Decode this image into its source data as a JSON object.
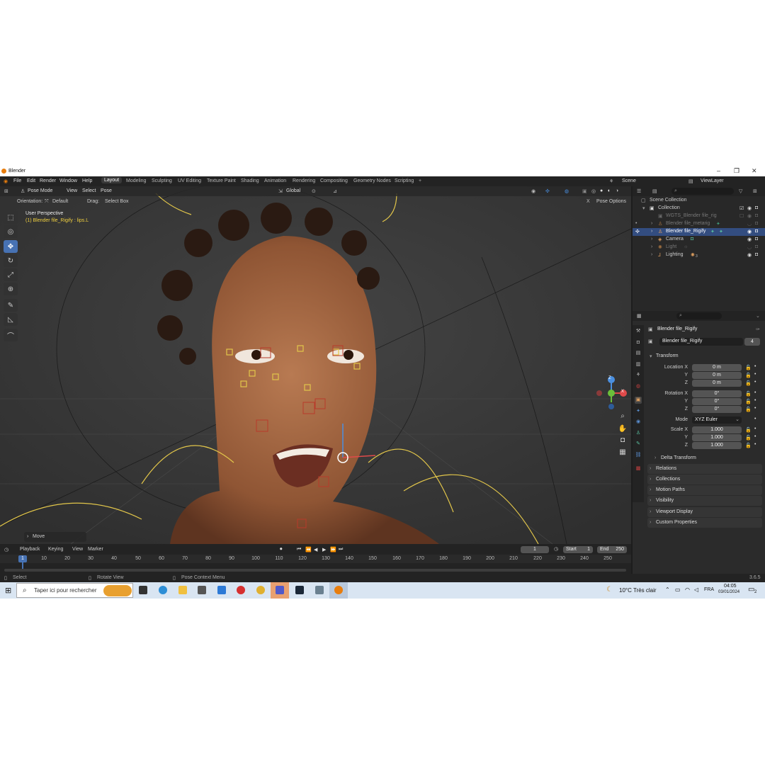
{
  "app": {
    "title": "Blender",
    "version": "3.6.5"
  },
  "menu": [
    "File",
    "Edit",
    "Render",
    "Window",
    "Help"
  ],
  "workspaces": [
    {
      "label": "Layout",
      "active": true
    },
    {
      "label": "Modeling"
    },
    {
      "label": "Sculpting"
    },
    {
      "label": "UV Editing"
    },
    {
      "label": "Texture Paint"
    },
    {
      "label": "Shading"
    },
    {
      "label": "Animation"
    },
    {
      "label": "Rendering"
    },
    {
      "label": "Compositing"
    },
    {
      "label": "Geometry Nodes"
    },
    {
      "label": "Scripting"
    }
  ],
  "scene": {
    "name": "Scene",
    "view_layer": "ViewLayer"
  },
  "viewport": {
    "mode": "Pose Mode",
    "view": "View",
    "select": "Select",
    "pose": "Pose",
    "transform_orientation": "Global",
    "orientation_label": "Orientation:",
    "orientation_value": "Default",
    "drag_label": "Drag:",
    "drag_value": "Select Box",
    "pose_options": "Pose Options",
    "overlay_title": "User Perspective",
    "overlay_object": "(1) Blender file_Rigify : lips.L",
    "last_op": "Move",
    "gizmo": {
      "x": "X",
      "y": "Y",
      "z": "Z"
    }
  },
  "outliner": {
    "items": [
      {
        "label": "Scene Collection",
        "depth": 0
      },
      {
        "label": "Collection",
        "depth": 1
      },
      {
        "label": "WGTS_Blender file_rig",
        "depth": 2,
        "dim": true
      },
      {
        "label": "Blender file_metarig",
        "depth": 2,
        "dim": true
      },
      {
        "label": "Blender file_Rigify",
        "depth": 2,
        "selected": true
      },
      {
        "label": "Camera",
        "depth": 2
      },
      {
        "label": "Light",
        "depth": 2,
        "dim": true
      },
      {
        "label": "Lighting",
        "depth": 2,
        "badge": "3"
      }
    ]
  },
  "properties": {
    "object_name": "Blender file_Rigify",
    "data_name": "Blender file_Rigify",
    "users": "4",
    "transform_header": "Transform",
    "location_label": "Location X",
    "loc": [
      "0 m",
      "0 m",
      "0 m"
    ],
    "rotation_label": "Rotation X",
    "rot": [
      "0°",
      "0°",
      "0°"
    ],
    "mode_label": "Mode",
    "mode_value": "XYZ Euler",
    "scale_label": "Scale X",
    "scale": [
      "1.000",
      "1.000",
      "1.000"
    ],
    "axis_y": "Y",
    "axis_z": "Z",
    "subsections": [
      "Delta Transform"
    ],
    "panels": [
      "Relations",
      "Collections",
      "Motion Paths",
      "Visibility",
      "Viewport Display",
      "Custom Properties"
    ]
  },
  "timeline": {
    "menus": [
      "Playback",
      "Keying",
      "View",
      "Marker"
    ],
    "current_frame": "1",
    "start_label": "Start",
    "start": "1",
    "end_label": "End",
    "end": "250",
    "ticks": [
      "10",
      "20",
      "30",
      "40",
      "50",
      "60",
      "70",
      "80",
      "90",
      "100",
      "110",
      "120",
      "130",
      "140",
      "150",
      "160",
      "170",
      "180",
      "190",
      "200",
      "210",
      "220",
      "230",
      "240",
      "250"
    ],
    "playhead": "1"
  },
  "status": {
    "left": "Select",
    "middle": "Rotate View",
    "right": "Pose Context Menu"
  },
  "taskbar": {
    "search_placeholder": "Taper ici pour rechercher",
    "weather": "10°C  Très clair",
    "lang": "FRA",
    "time": "04:05",
    "date": "03/01/2024",
    "notifications": "2"
  }
}
